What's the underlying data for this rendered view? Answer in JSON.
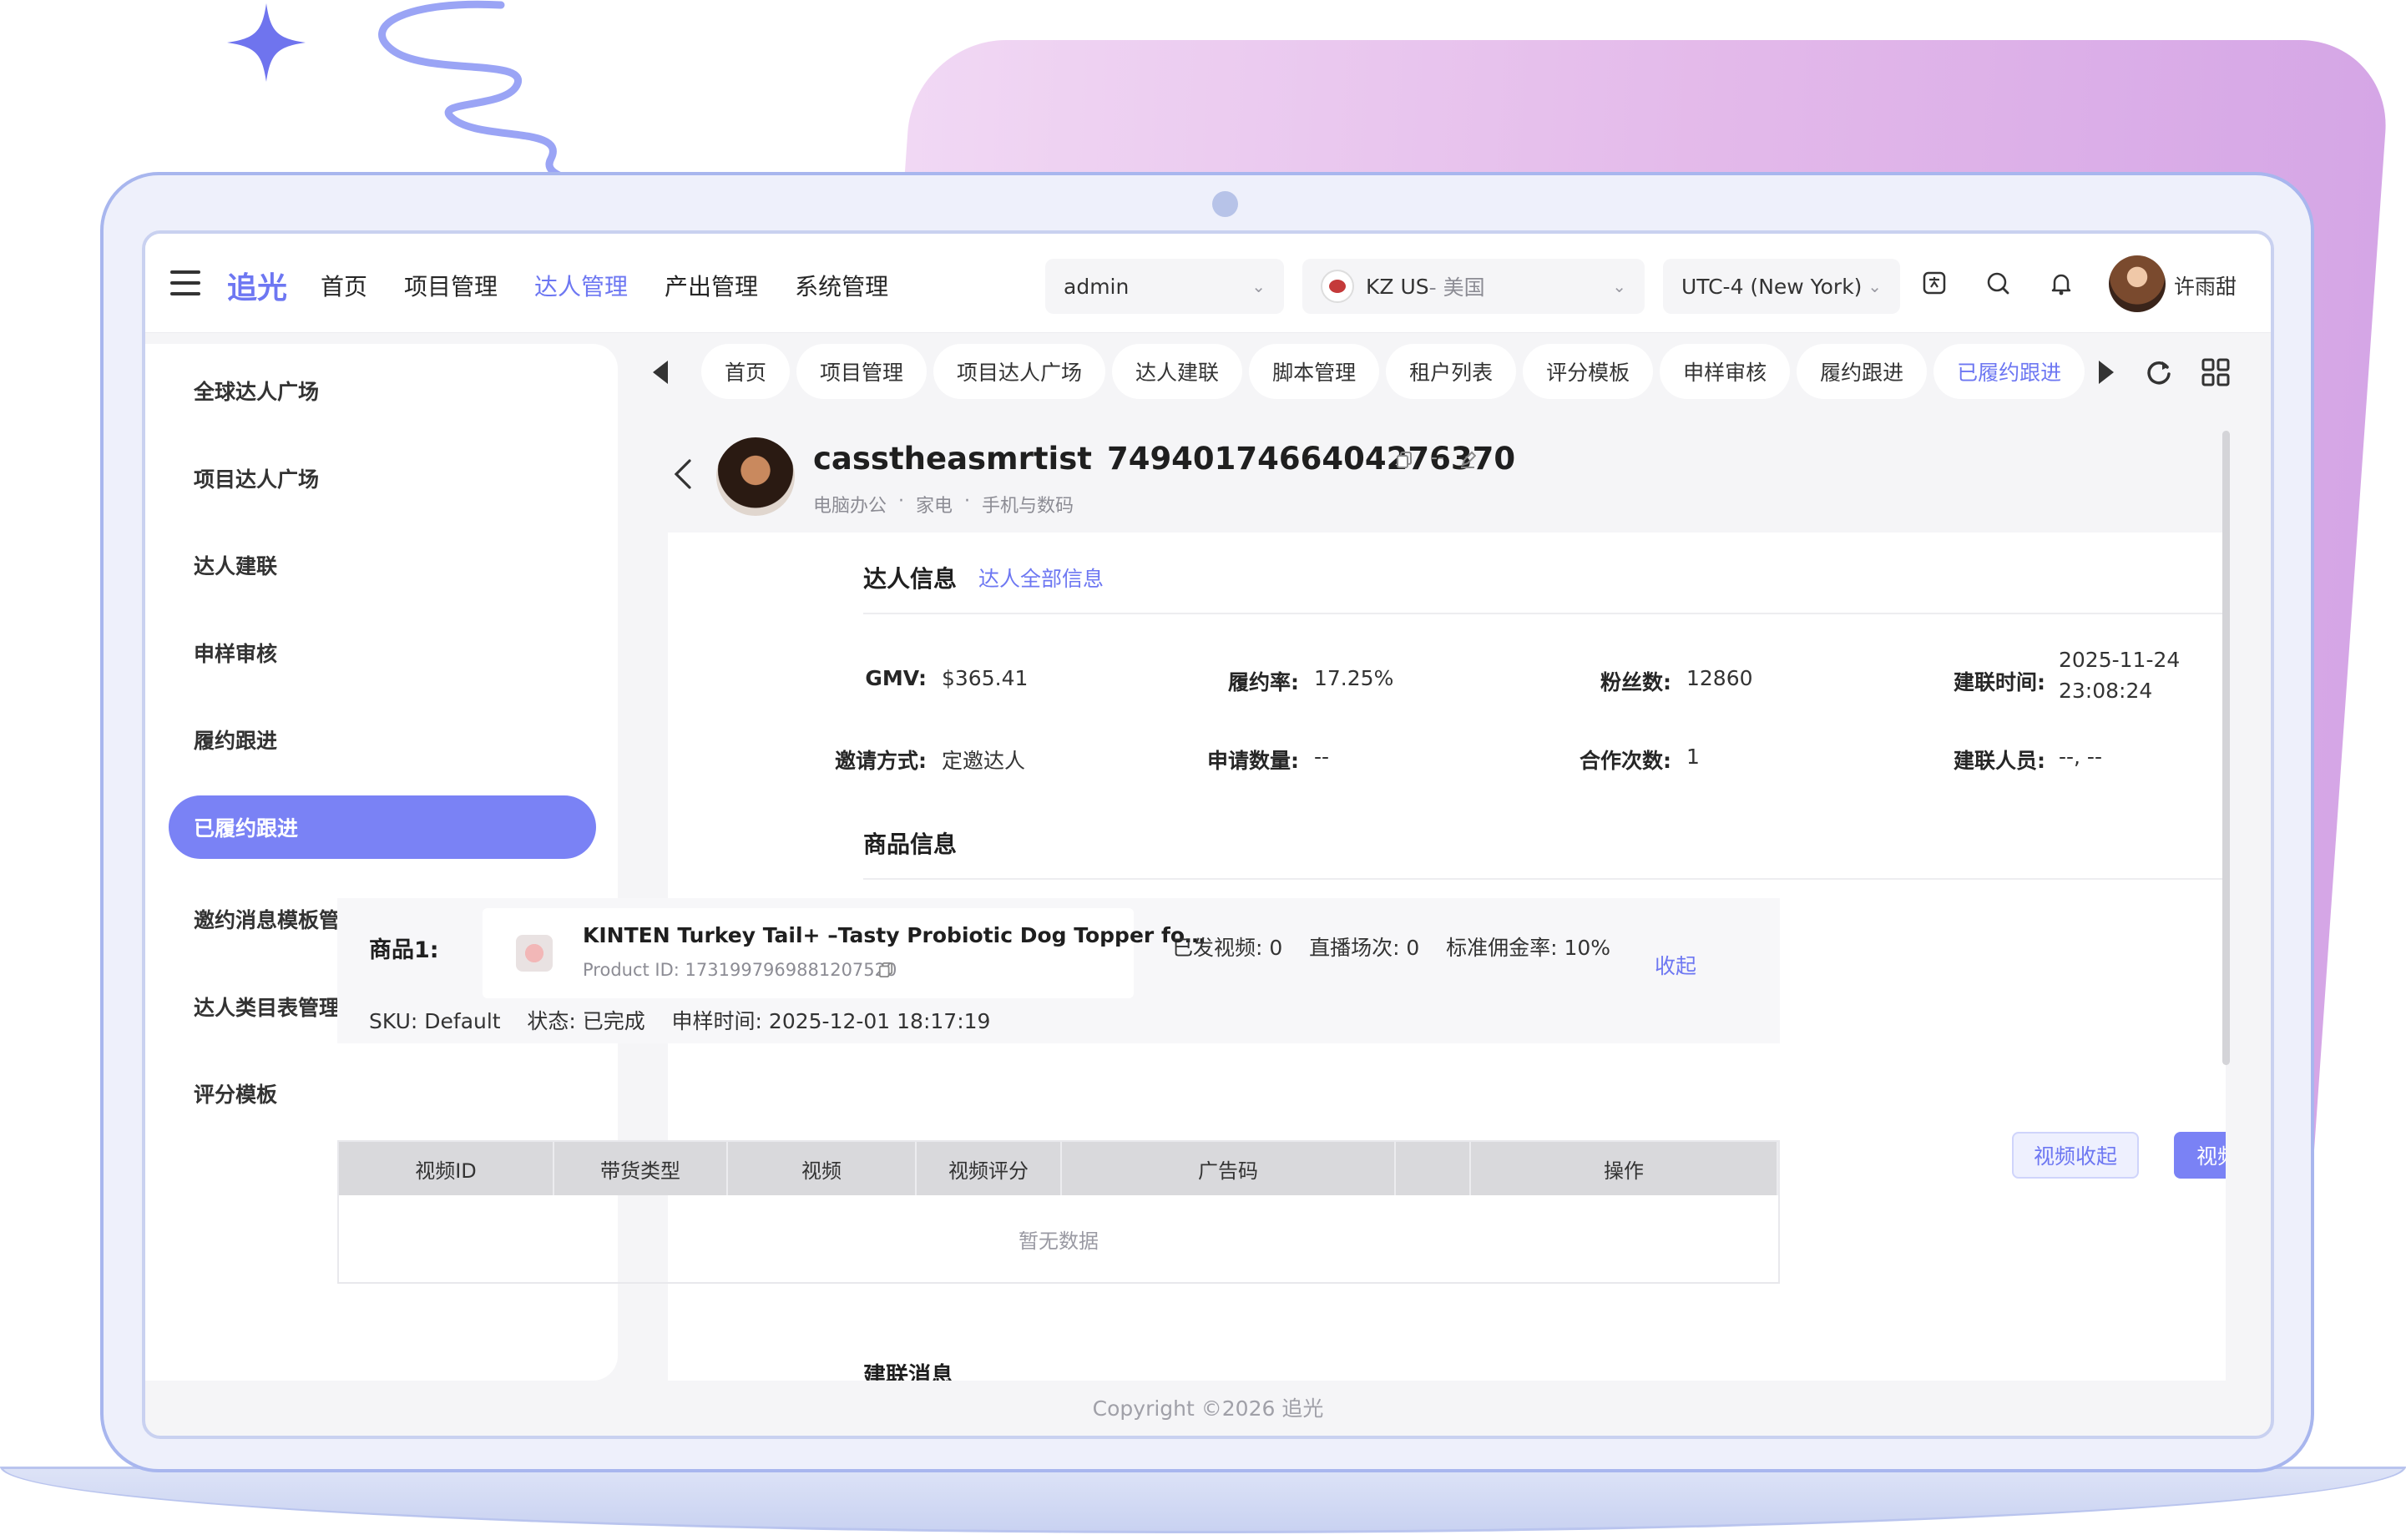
{
  "brand": "追光",
  "nav": [
    "首页",
    "项目管理",
    "达人管理",
    "产出管理",
    "系统管理"
  ],
  "nav_active": 2,
  "header": {
    "user_select": "admin",
    "shop_name": "KZ US",
    "shop_region": " - 美国",
    "timezone": "UTC-4 (New York)",
    "username": "许雨甜"
  },
  "sidebar": {
    "items": [
      "全球达人广场",
      "项目达人广场",
      "达人建联",
      "申样审核",
      "履约跟进",
      "已履约跟进",
      "邀约消息模板管理",
      "达人类目表管理",
      "评分模板"
    ],
    "active": 5
  },
  "tabs": {
    "items": [
      "首页",
      "项目管理",
      "项目达人广场",
      "达人建联",
      "脚本管理",
      "租户列表",
      "评分模板",
      "申样审核",
      "履约跟进",
      "已履约跟进"
    ],
    "active": 9
  },
  "creator": {
    "handle": "casstheasmrtist",
    "id": "7494017466404276370",
    "note": "--",
    "categories": [
      "电脑办公",
      "·",
      "家电",
      "·",
      "手机与数码"
    ]
  },
  "creator_info": {
    "title": "达人信息",
    "link": "达人全部信息",
    "rows": [
      [
        {
          "label": "GMV:",
          "value": "$365.41"
        },
        {
          "label": "履约率:",
          "value": "17.25%"
        },
        {
          "label": "粉丝数:",
          "value": "12860"
        },
        {
          "label": "建联时间:",
          "value": "2025-11-24",
          "value2": "23:08:24"
        }
      ],
      [
        {
          "label": "邀请方式:",
          "value": "定邀达人"
        },
        {
          "label": "申请数量:",
          "value": "--"
        },
        {
          "label": "合作次数:",
          "value": "1"
        },
        {
          "label": "建联人员:",
          "value": "--, --"
        }
      ]
    ]
  },
  "product_info": {
    "title": "商品信息",
    "btn_collapse_video": "视频收起",
    "btn_expand_video": "视频展开",
    "product_label": "商品1:",
    "product_name": "KINTEN Turkey Tail+ –Tasty Probiotic Dog Topper fo…",
    "product_id": "Product ID: 1731997969881207520",
    "stats": "已发视频: 0    直播场次: 0    标准佣金率: 10%",
    "collapse": "收起",
    "sku_line": "SKU: Default    状态: 已完成    申样时间: 2025-12-01 18:17:19"
  },
  "table": {
    "headers": [
      "视频ID",
      "带货类型",
      "视频",
      "视频评分",
      "广告码",
      "",
      "操作"
    ],
    "empty": "暂无数据"
  },
  "next_section": "建联消息",
  "footer": "Copyright ©2026 追光",
  "colors": {
    "accent": "#6d77f2",
    "sidebar_active": "#7a82f5",
    "frame": "#a8b6ee"
  }
}
